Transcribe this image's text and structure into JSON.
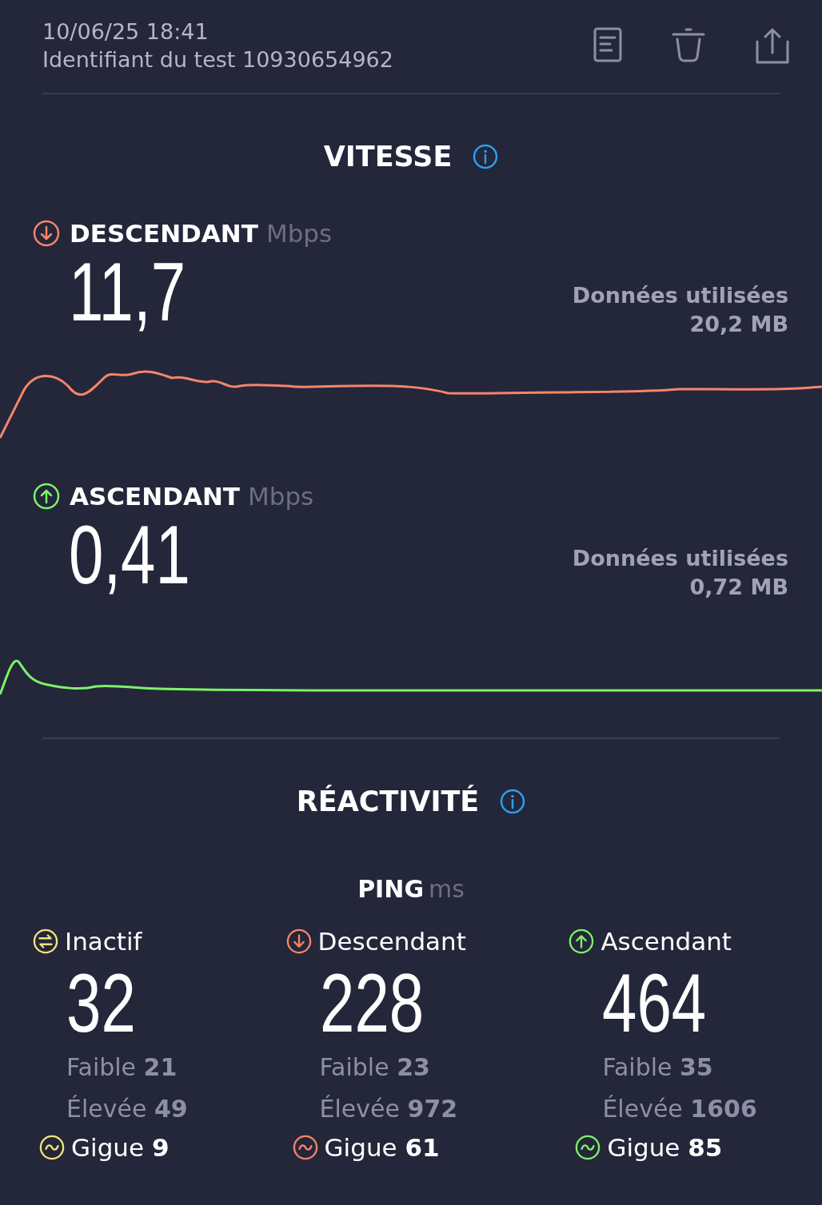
{
  "header": {
    "datetime": "10/06/25 18:41",
    "test_id": "Identifiant du test 10930654962"
  },
  "speed": {
    "title": "VITESSE",
    "tests": [
      {
        "kind": "down",
        "color": "#f4856a",
        "label": "DESCENDANT",
        "unit": "Mbps",
        "value": "11,7",
        "data_label": "Données utilisées",
        "data_value": "20,2 MB"
      },
      {
        "kind": "up",
        "color": "#7cf26a",
        "label": "ASCENDANT",
        "unit": "Mbps",
        "value": "0,41",
        "data_label": "Données utilisées",
        "data_value": "0,72 MB"
      }
    ]
  },
  "responsiveness": {
    "title": "RÉACTIVITÉ",
    "ping_label": "PING",
    "ping_unit": "ms",
    "columns": [
      {
        "kind": "idle",
        "color": "#f2e27a",
        "label": "Inactif",
        "value": "32",
        "low": "Faible **21**",
        "high": "Élevée **49**",
        "jitter": "Gigue **9**"
      },
      {
        "kind": "down",
        "color": "#f4856a",
        "label": "Descendant",
        "value": "228",
        "low": "Faible **23**",
        "high": "Élevée **972**",
        "jitter": "Gigue **61**"
      },
      {
        "kind": "up",
        "color": "#7cf26a",
        "label": "Ascendant",
        "value": "464",
        "low": "Faible **35**",
        "high": "Élevée **1606**",
        "jitter": "Gigue **85**"
      }
    ]
  }
}
